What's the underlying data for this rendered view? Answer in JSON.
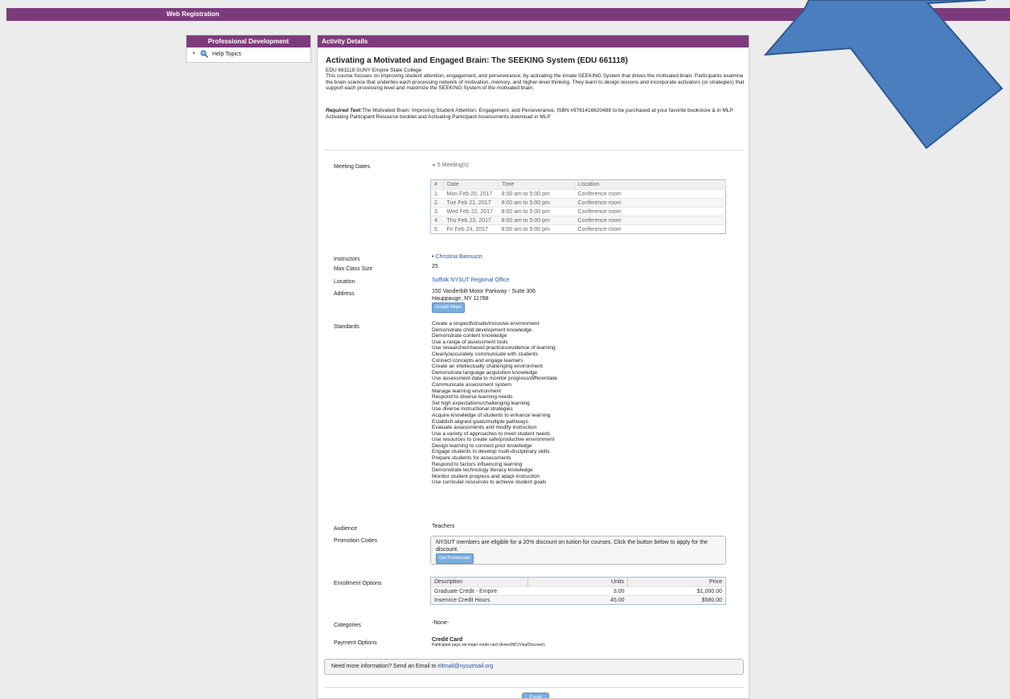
{
  "topbar": {
    "title": "Web Registration"
  },
  "sidebar": {
    "header": "Professional Development",
    "items": [
      {
        "label": "Help Topics"
      }
    ]
  },
  "main": {
    "header": "Activity Details",
    "title": "Activating a Motivated and Engaged Brain: The SEEKING System (EDU 661118)",
    "code_line": "EDU 661118 SUNY Empire State College",
    "description": "This course focuses on improving student attention, engagement, and perseverance, by activating the innate SEEKING System that drives the motivated brain. Participants examine the brain science that underlies each processing network of motivation, memory, and higher-level thinking. They learn to design lessons and incorporate activators (or strategies) that support each processing level and maximize the SEEKING System of the motivated brain.",
    "required_text_label": "Required Text:",
    "required_text": "The Motivated Brain: Improving Student Attention, Engagement, and Perseverance, ISBN #9781416620488 to be purchased at your favorite bookstore & in MLP Activating Participant Resource booklet and Activating Participant Assessments download in MLP",
    "meeting_dates_label": "Meeting Dates",
    "meeting_count": "5 Meeting(s)",
    "meeting_columns": [
      "#",
      "Date",
      "Time",
      "Location"
    ],
    "meetings": [
      {
        "num": "1.",
        "date": "Mon Feb 20, 2017",
        "time": "8:00 am to 5:00 pm",
        "location": "Conference room"
      },
      {
        "num": "2.",
        "date": "Tue Feb 21, 2017",
        "time": "8:00 am to 5:00 pm",
        "location": "Conference room"
      },
      {
        "num": "3.",
        "date": "Wed Feb 22, 2017",
        "time": "8:00 am to 5:00 pm",
        "location": "Conference room"
      },
      {
        "num": "4.",
        "date": "Thu Feb 23, 2017",
        "time": "8:00 am to 5:00 pm",
        "location": "Conference room"
      },
      {
        "num": "5.",
        "date": "Fri Feb 24, 2017",
        "time": "8:00 am to 5:00 pm",
        "location": "Conference room"
      }
    ],
    "instructors_label": "Instructors",
    "instructor": "Christina Bannuzzi",
    "max_class_label": "Max Class Size",
    "max_class": "25",
    "location_label": "Location",
    "location": "Suffolk NYSUT Regional Office",
    "address_label": "Address",
    "address_line1": "150 Vanderbilt Motor Parkway - Suite 306",
    "address_line2": "Hauppauge, NY 11788",
    "maps_button": "Google Maps",
    "standards_label": "Standards",
    "standards": [
      "Create a respectful/safe/inclusive environment",
      "Demonstrate child development knowledge",
      "Demonstrate content knowledge",
      "Use a range of assessment tools",
      "Use researched-based practices/evidence of learning",
      "Clearly/accurately communicate with students",
      "Connect concepts and engage learners",
      "Create an intellectually challenging environment",
      "Demonstrate language acquisition knowledge",
      "Use assessment data to monitor progress/differentiate",
      "Communicate assessment system",
      "Manage learning environment",
      "Respond to diverse learning needs",
      "Set high expectations/challenging learning",
      "Use diverse instructional strategies",
      "Acquire knowledge of students to enhance learning",
      "Establish aligned goals/multiple pathways",
      "Evaluate assessments and modify instruction",
      "Use a variety of approaches to meet student needs",
      "Use resources to create safe/productive environment",
      "Design learning to connect prior knowledge",
      "Engage students to develop multi-disciplinary skills",
      "Prepare students for assessments",
      "Respond to factors influencing learning",
      "Demonstrate technology literacy knowledge",
      "Monitor student progress and adapt instruction",
      "Use curricular resources to achieve student goals"
    ],
    "audience_label": "Audience",
    "audience": "Teachers",
    "promo_label": "Promotion Codes",
    "promo_text": "NYSUT members are eligible for a 20% discount on tuition for courses. Click the button below to apply for the discount.",
    "promo_button": "Get Promocode",
    "enrollment_label": "Enrollment Options",
    "enrollment_columns": [
      "Description",
      "Units",
      "Price"
    ],
    "enrollment": [
      {
        "desc": "Graduate Credit - Empire",
        "units": "3.00",
        "price": "$1,000.00"
      },
      {
        "desc": "Inservice Credit Hours",
        "units": "45.00",
        "price": "$580.00"
      }
    ],
    "categories_label": "Categories",
    "categories": "-None-",
    "payment_label": "Payment Options",
    "payment_title": "Credit Card",
    "payment_note": "Participant pays via major credit card (Amex/MC/Visa/Discover).",
    "info_text": "Need more information? Send an Email to ",
    "info_email": "eltmail@nysutmail.org",
    "enroll_button": "Enroll"
  },
  "colors": {
    "brand": "#7d3b7d",
    "link": "#2255aa",
    "arrow": "#4a7ebf"
  }
}
